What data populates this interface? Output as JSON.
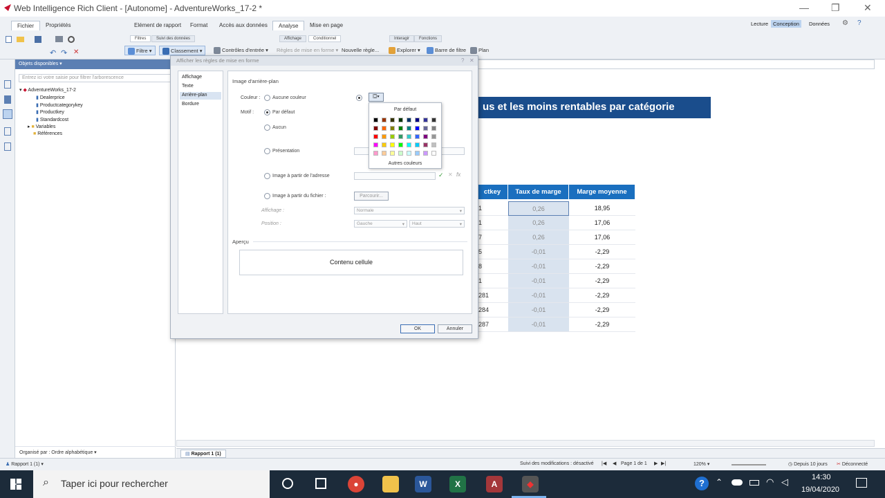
{
  "app": {
    "title": "Web Intelligence Rich Client - [Autonome] - AdventureWorks_17-2 *"
  },
  "ribbon": {
    "left_tabs": [
      "Fichier",
      "Propriétés"
    ],
    "main_tabs": [
      "Elément de rapport",
      "Format",
      "Accès aux données",
      "Analyse",
      "Mise en page"
    ],
    "selected_tab": "Analyse",
    "sub_groups": [
      "Filtres",
      "Suivi des données",
      "Affichage",
      "Conditionnel",
      "Interagir",
      "Fonctions"
    ],
    "tools": {
      "filtre": "Filtre",
      "classement": "Classement",
      "controles": "Contrôles d'entrée",
      "regles": "Règles de mise en forme",
      "nouvelle": "Nouvelle règle...",
      "explorer": "Explorer",
      "barre_filtre": "Barre de filtre",
      "plan": "Plan"
    },
    "modes": {
      "lecture": "Lecture",
      "conception": "Conception",
      "donnees": "Données"
    }
  },
  "objects": {
    "header": "Objets disponibles",
    "search_placeholder": "Entrez ici votre saisie pour filtrer l'arborescence",
    "root": "AdventureWorks_17-2",
    "items": [
      "Dealerprice",
      "Productcategorykey",
      "Productkey",
      "Standardcost",
      "Variables",
      "Références"
    ],
    "footer": "Organisé par : Ordre alphabétique"
  },
  "report": {
    "title_fragment": "us et les moins rentables par catégorie",
    "columns": [
      "ctkey",
      "Taux de marge",
      "Marge moyenne"
    ],
    "rows": [
      [
        "1",
        "0,26",
        "18,95"
      ],
      [
        "1",
        "0,26",
        "17,06"
      ],
      [
        "7",
        "0,26",
        "17,06"
      ],
      [
        "5",
        "-0,01",
        "-2,29"
      ],
      [
        "8",
        "-0,01",
        "-2,29"
      ],
      [
        "1",
        "-0,01",
        "-2,29"
      ],
      [
        "281",
        "-0,01",
        "-2,29"
      ],
      [
        "284",
        "-0,01",
        "-2,29"
      ],
      [
        "287",
        "-0,01",
        "-2,29"
      ]
    ],
    "page_tab": "Rapport 1 (1)"
  },
  "dialog": {
    "title": "Afficher les règles de mise en forme",
    "nav": [
      "Affichage",
      "Texte",
      "Arrière-plan",
      "Bordure"
    ],
    "nav_selected": "Arrière-plan",
    "section": "Image d'arrière-plan",
    "couleur_label": "Couleur :",
    "aucune_couleur": "Aucune couleur",
    "motif_label": "Motif :",
    "par_defaut": "Par défaut",
    "aucun": "Aucun",
    "presentation": "Présentation",
    "image_adresse": "Image à partir de l'adresse",
    "image_fichier": "Image à partir du fichier :",
    "parcourir": "Parcourir...",
    "affichage_label": "Affichage :",
    "affichage_value": "Normale",
    "position_label": "Position :",
    "position_h": "Gauche",
    "position_v": "Haut",
    "apercu": "Aperçu",
    "preview_text": "Contenu cellule",
    "ok": "OK",
    "annuler": "Annuler"
  },
  "palette": {
    "title": "Par défaut",
    "more": "Autres couleurs",
    "colors": [
      [
        "#000000",
        "#993300",
        "#333300",
        "#003300",
        "#003366",
        "#000080",
        "#333399",
        "#333333"
      ],
      [
        "#800000",
        "#FF6600",
        "#808000",
        "#008000",
        "#008080",
        "#0000FF",
        "#666699",
        "#808080"
      ],
      [
        "#FF0000",
        "#FF9900",
        "#99CC00",
        "#339966",
        "#33CCCC",
        "#3366FF",
        "#800080",
        "#969696"
      ],
      [
        "#FF00FF",
        "#FFCC00",
        "#FFFF00",
        "#00FF00",
        "#00FFFF",
        "#00CCFF",
        "#993366",
        "#C0C0C0"
      ],
      [
        "#FF99CC",
        "#FFCC99",
        "#FFFF99",
        "#CCFFCC",
        "#CCFFFF",
        "#99CCFF",
        "#CC99FF",
        "#FFFFFF"
      ]
    ]
  },
  "status": {
    "left": "Rapport 1 (1)",
    "tracking": "Suivi des modifications : désactivé",
    "page": "Page 1 de 1",
    "zoom": "120%",
    "refresh": "Depuis 10 jours",
    "connection": "Déconnecté"
  },
  "taskbar": {
    "search": "Taper ici pour rechercher",
    "time": "14:30",
    "date": "19/04/2020"
  }
}
